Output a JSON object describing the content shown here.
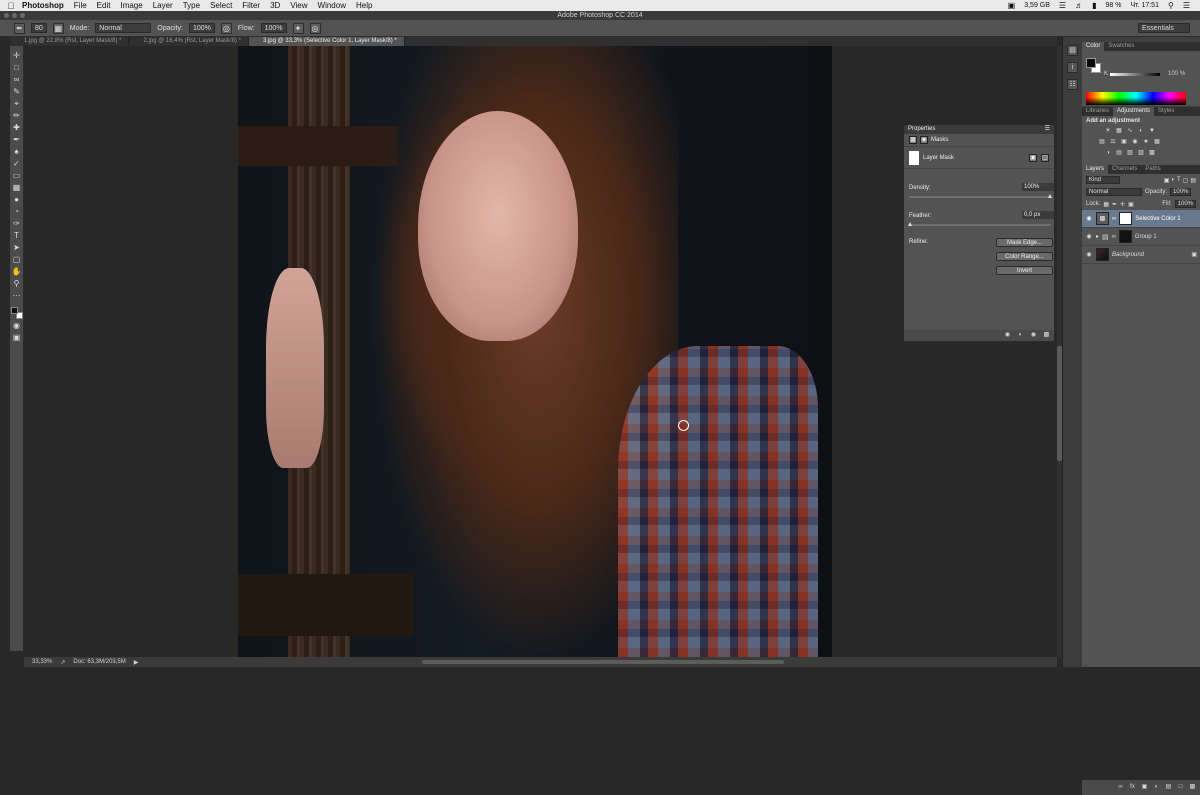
{
  "menubar": {
    "app": "Photoshop",
    "items": [
      "File",
      "Edit",
      "Image",
      "Layer",
      "Type",
      "Select",
      "Filter",
      "3D",
      "View",
      "Window",
      "Help"
    ],
    "status_memory": "3,59 GB",
    "status_battery": "98 %",
    "status_day_time": "Чт. 17:51"
  },
  "window": {
    "title": "Adobe Photoshop CC 2014"
  },
  "options": {
    "brush_size": "80",
    "mode_label": "Mode:",
    "mode_value": "Normal",
    "opacity_label": "Opacity:",
    "opacity_value": "100%",
    "flow_label": "Flow:",
    "flow_value": "100%",
    "workspace": "Essentials"
  },
  "tabs": [
    {
      "label": "1.jpg @ 22,8% (Rst, Layer Mask/8) *"
    },
    {
      "label": "2.jpg @ 16,4% (Rst, Layer Mask/8) *"
    },
    {
      "label": "3.jpg @ 33,3% (Selective Color 1, Layer Mask/8) *",
      "active": true
    }
  ],
  "status": {
    "zoom": "33,33%",
    "doc": "Doc: 63,3M/203,5M"
  },
  "color_panel": {
    "tabs": [
      "Color",
      "Swatches"
    ],
    "channel": "K",
    "value": "100",
    "unit": "%"
  },
  "adjustments_panel": {
    "tabs": [
      "Libraries",
      "Adjustments",
      "Styles"
    ],
    "header": "Add an adjustment"
  },
  "layers_panel": {
    "tabs": [
      "Layers",
      "Channels",
      "Paths"
    ],
    "filter_label": "Kind",
    "blend_mode": "Normal",
    "opacity_label": "Opacity:",
    "opacity_value": "100%",
    "lock_label": "Lock:",
    "fill_label": "Fill:",
    "fill_value": "100%",
    "layers": [
      {
        "name": "Selective Color 1",
        "selected": true
      },
      {
        "name": "Group 1"
      },
      {
        "name": "Background"
      }
    ]
  },
  "properties_panel": {
    "title": "Properties",
    "section": "Masks",
    "mask_label": "Layer Mask",
    "density_label": "Density:",
    "density_value": "100%",
    "feather_label": "Feather:",
    "feather_value": "0,0 px",
    "refine_label": "Refine:",
    "buttons": [
      "Mask Edge...",
      "Color Range...",
      "Invert"
    ]
  }
}
